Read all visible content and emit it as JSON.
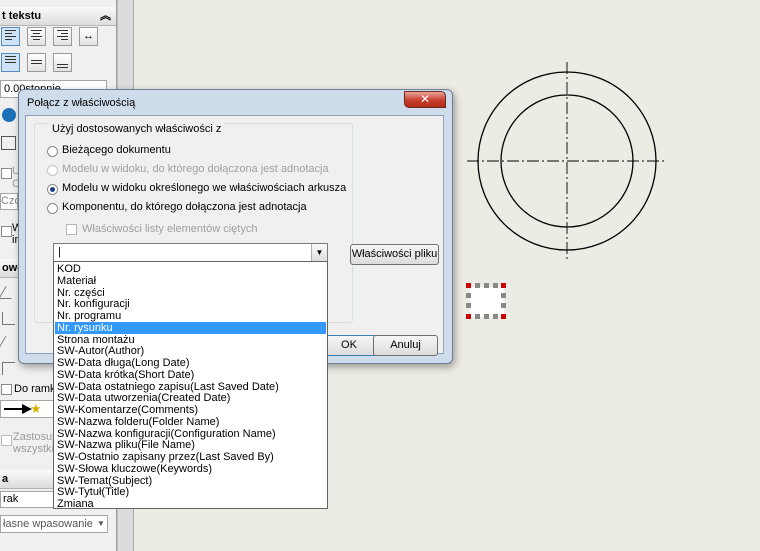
{
  "panel": {
    "section_text_title": "t tekstu",
    "angle_value": "0.00stopnie",
    "frame_label": "Do ramki",
    "apply_label": "Zastosuj",
    "apply_label2": "wszystkie",
    "frag_ce": "Ce",
    "frag_cz": "Czc",
    "frag_w": "W",
    "frag_in": "in",
    "frag_ul": "U",
    "section_leader_title": "owodą",
    "section_a_title": "a",
    "rak_value": "rak",
    "fit_value": "łasne wpasowanie"
  },
  "dialog": {
    "title": "Połącz z właściwością",
    "close": "✕",
    "group_label": "Użyj dostosowanych właściwości z",
    "options": [
      {
        "label": "Bieżącego dokumentu",
        "enabled": true,
        "selected": false
      },
      {
        "label": "Modelu w widoku, do którego dołączona jest adnotacja",
        "enabled": false,
        "selected": false
      },
      {
        "label": "Modelu w widoku określonego we właściwościach arkusza",
        "enabled": true,
        "selected": true
      },
      {
        "label": "Komponentu, do którego dołączona jest adnotacja",
        "enabled": true,
        "selected": false
      }
    ],
    "checkbox_label": "Właściwości listy elementów ciętych",
    "combo_value": "|",
    "file_props_button": "Właściwości pliku",
    "ok_button": "OK",
    "cancel_button": "Anuluj"
  },
  "dropdown": {
    "items": [
      "KOD",
      "Materiał",
      "Nr. części",
      "Nr. konfiguracji",
      "Nr. programu",
      "Nr. rysunku",
      "Strona montażu",
      "SW-Autor(Author)",
      "SW-Data długa(Long Date)",
      "SW-Data krótka(Short Date)",
      "SW-Data ostatniego zapisu(Last Saved Date)",
      "SW-Data utworzenia(Created Date)",
      "SW-Komentarze(Comments)",
      "SW-Nazwa folderu(Folder Name)",
      "SW-Nazwa konfiguracji(Configuration Name)",
      "SW-Nazwa pliku(File Name)",
      "SW-Ostatnio zapisany przez(Last Saved By)",
      "SW-Słowa kluczowe(Keywords)",
      "SW-Temat(Subject)",
      "SW-Tytuł(Title)",
      "Zmiana"
    ],
    "highlighted_index": 5
  },
  "colors": {
    "highlight": "#3399ff",
    "selection_handle": "#cc0000",
    "dialog_frame": "#cfdcec"
  }
}
